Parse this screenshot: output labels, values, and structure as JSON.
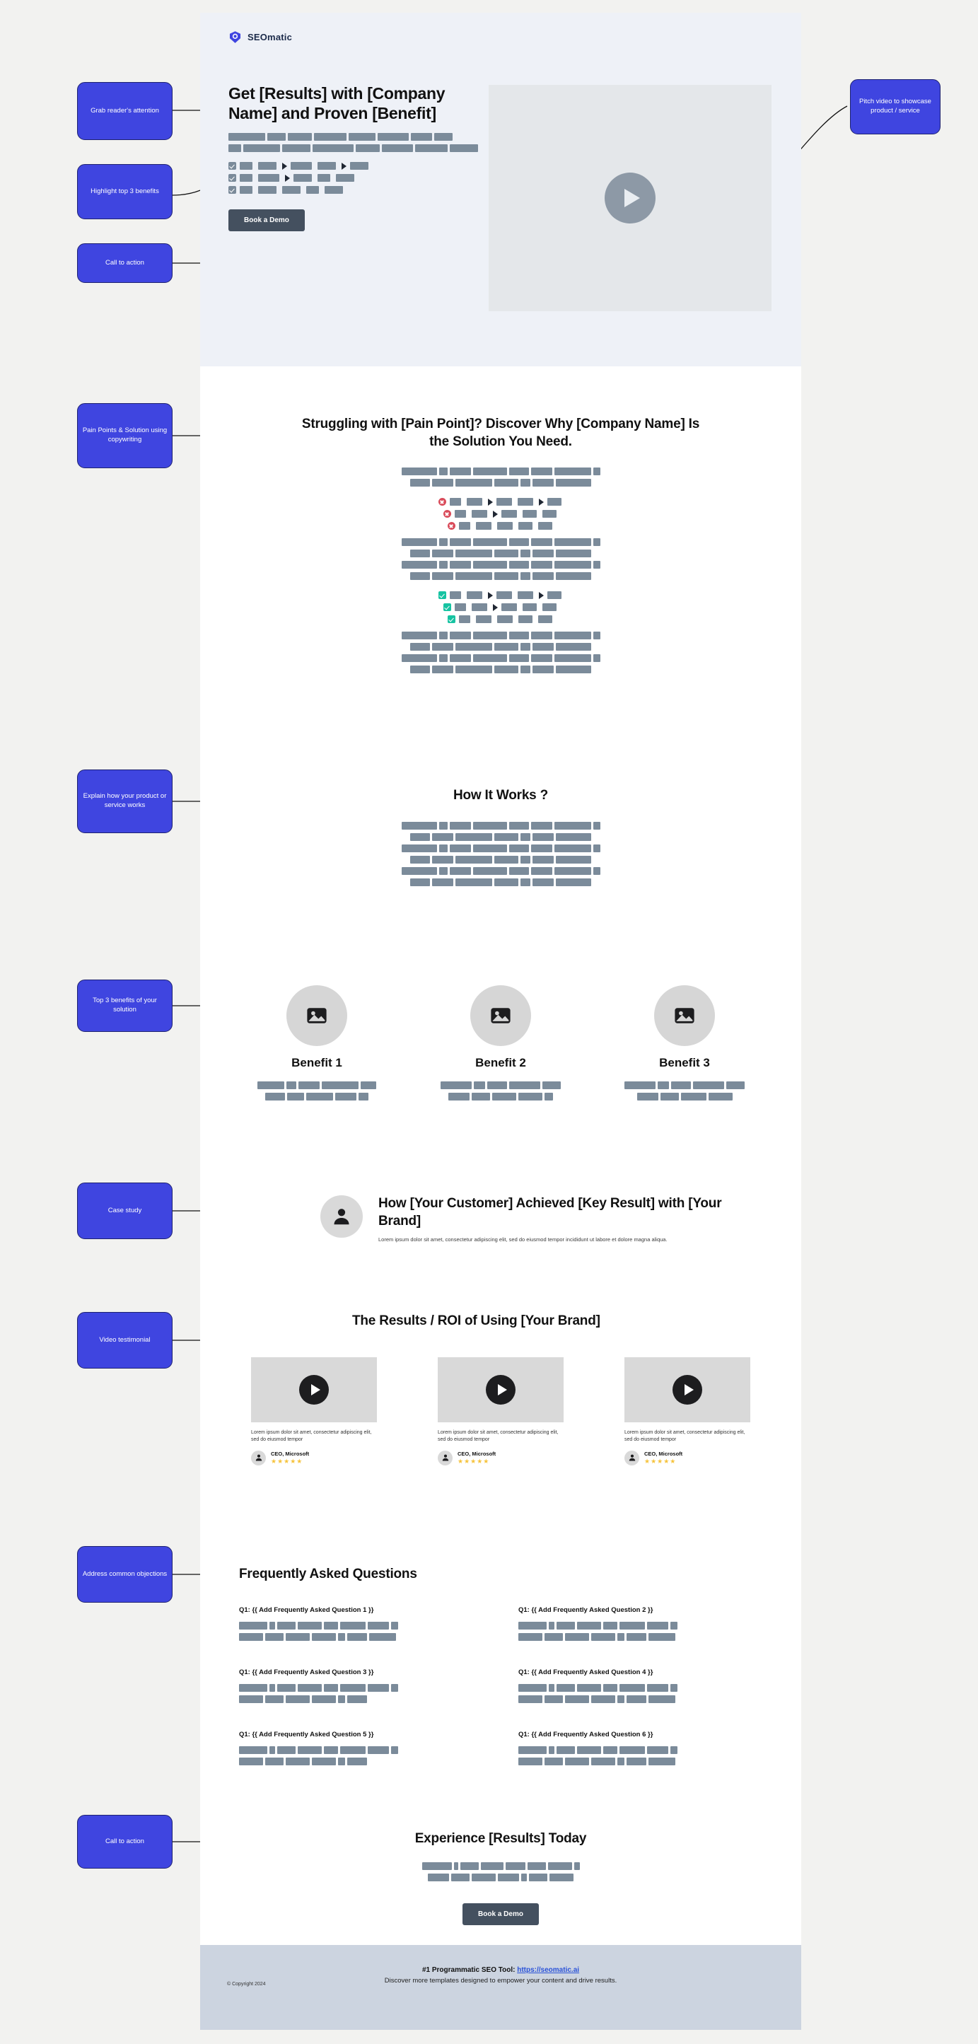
{
  "brand": {
    "name": "SEOmatic",
    "accent": "#3f45e0",
    "logo_icon": "seomatic-logo-icon"
  },
  "notes": [
    {
      "id": "n1",
      "label": "Grab reader's attention"
    },
    {
      "id": "n2",
      "label": "Highlight top 3 benefits"
    },
    {
      "id": "n3",
      "label": "Call to action"
    },
    {
      "id": "n4",
      "label": "Pitch video to showcase product / service"
    },
    {
      "id": "n5",
      "label": "Pain Points & Solution using copywriting"
    },
    {
      "id": "n6",
      "label": "Explain how your product or service works"
    },
    {
      "id": "n7",
      "label": "Top 3 benefits of your solution"
    },
    {
      "id": "n8",
      "label": "Case study"
    },
    {
      "id": "n9",
      "label": "Video testimonial"
    },
    {
      "id": "n10",
      "label": "Address common objections"
    },
    {
      "id": "n11",
      "label": "Call to action"
    }
  ],
  "hero": {
    "title": "Get [Results] with [Company Name] and Proven [Benefit]",
    "cta_label": "Book a Demo",
    "video_icon": "play-icon",
    "paragraph_rows": [
      [
        52,
        26,
        34,
        46,
        38,
        44,
        30,
        26
      ],
      [
        18,
        52,
        40,
        58,
        34,
        44,
        46,
        40
      ]
    ],
    "checklist": [
      {
        "state": "checked",
        "segments": [
          18,
          26,
          30,
          26,
          26
        ]
      },
      {
        "state": "checked",
        "segments": [
          18,
          30,
          26,
          18,
          26
        ]
      },
      {
        "state": "checked",
        "segments": [
          18,
          26,
          26,
          18,
          26
        ]
      }
    ]
  },
  "pain_section": {
    "title": "Struggling with [Pain Point]? Discover Why [Company Name] Is the Solution You Need.",
    "intro_rows": [
      [
        50,
        12,
        30,
        48,
        28,
        30,
        52,
        10
      ],
      [
        28,
        30,
        52,
        34,
        14,
        30,
        50
      ]
    ],
    "negatives": [
      {
        "state": "cross",
        "segments": [
          16,
          22,
          22,
          22,
          20
        ]
      },
      {
        "state": "cross",
        "segments": [
          16,
          22,
          22,
          20,
          20
        ]
      },
      {
        "state": "cross",
        "segments": [
          16,
          22,
          22,
          20,
          20
        ]
      }
    ],
    "mid_rows": [
      [
        50,
        12,
        30,
        48,
        28,
        30,
        52,
        10
      ],
      [
        28,
        30,
        52,
        34,
        14,
        30,
        50
      ],
      [
        50,
        12,
        30,
        48,
        28,
        30,
        52,
        10
      ],
      [
        28,
        30,
        52,
        34,
        14,
        30,
        50
      ]
    ],
    "positives": [
      {
        "state": "checked",
        "segments": [
          16,
          22,
          22,
          22,
          20
        ]
      },
      {
        "state": "checked",
        "segments": [
          16,
          22,
          22,
          20,
          20
        ]
      },
      {
        "state": "checked",
        "segments": [
          16,
          22,
          22,
          20,
          20
        ]
      }
    ],
    "end_rows": [
      [
        50,
        12,
        30,
        48,
        28,
        30,
        52,
        10
      ],
      [
        28,
        30,
        52,
        34,
        14,
        30,
        50
      ],
      [
        50,
        12,
        30,
        48,
        28,
        30,
        52,
        10
      ],
      [
        28,
        30,
        52,
        34,
        14,
        30,
        50
      ]
    ]
  },
  "how_it_works": {
    "title": "How It Works ?",
    "rows": [
      [
        50,
        12,
        30,
        48,
        28,
        30,
        52,
        10
      ],
      [
        28,
        30,
        52,
        34,
        14,
        30,
        50
      ],
      [
        50,
        12,
        30,
        48,
        28,
        30,
        52,
        10
      ],
      [
        28,
        30,
        52,
        34,
        14,
        30,
        50
      ],
      [
        50,
        12,
        30,
        48,
        28,
        30,
        52,
        10
      ],
      [
        28,
        30,
        52,
        34,
        14,
        30,
        50
      ]
    ]
  },
  "benefits": {
    "image_icon": "image-placeholder-icon",
    "items": [
      {
        "label": "Benefit 1",
        "rows": [
          [
            38,
            14,
            30,
            52,
            22
          ],
          [
            28,
            24,
            38,
            30,
            14
          ]
        ]
      },
      {
        "label": "Benefit 2",
        "rows": [
          [
            44,
            16,
            28,
            44,
            26
          ],
          [
            30,
            26,
            34,
            34,
            12
          ]
        ]
      },
      {
        "label": "Benefit 3",
        "rows": [
          [
            44,
            16,
            28,
            44,
            26
          ],
          [
            30,
            26,
            36,
            34
          ]
        ]
      }
    ]
  },
  "case_study": {
    "avatar_icon": "user-avatar-icon",
    "title": "How [Your Customer] Achieved [Key Result] with [Your Brand]",
    "body": "Lorem ipsum dolor sit amet, consectetur adipiscing elit, sed do eiusmod tempor incididunt ut labore et dolore magna aliqua."
  },
  "results": {
    "title": "The Results / ROI of Using [Your Brand]",
    "play_icon": "play-icon",
    "avatar_icon": "user-avatar-icon",
    "stars": "★★★★★",
    "cards": [
      {
        "quote": "Lorem ipsum dolor sit amet, consectetur adipiscing elit, sed do eiusmod tempor",
        "name": "CEO, Microsoft"
      },
      {
        "quote": "Lorem ipsum dolor sit amet, consectetur adipiscing elit, sed do eiusmod tempor",
        "name": "CEO, Microsoft"
      },
      {
        "quote": "Lorem ipsum dolor sit amet, consectetur adipiscing elit, sed do eiusmod tempor",
        "name": "CEO, Microsoft"
      }
    ]
  },
  "faq": {
    "title": "Frequently Asked Questions",
    "items": [
      {
        "question": "Q1: {{ Add Frequently Asked Question 1 }}",
        "rows": [
          [
            40,
            8,
            26,
            34,
            20,
            36,
            30,
            10
          ],
          [
            34,
            26,
            34,
            34,
            10,
            28,
            38
          ]
        ]
      },
      {
        "question": "Q1: {{ Add Frequently Asked Question 2 }}",
        "rows": [
          [
            40,
            8,
            26,
            34,
            20,
            36,
            30,
            10
          ],
          [
            34,
            26,
            34,
            34,
            10,
            28,
            38
          ]
        ]
      },
      {
        "question": "Q1: {{ Add Frequently Asked Question 3 }}",
        "rows": [
          [
            40,
            8,
            26,
            34,
            20,
            36,
            30,
            10
          ],
          [
            34,
            26,
            34,
            34,
            10,
            28
          ]
        ]
      },
      {
        "question": "Q1: {{ Add Frequently Asked Question 4 }}",
        "rows": [
          [
            40,
            8,
            26,
            34,
            20,
            36,
            30,
            10
          ],
          [
            34,
            26,
            34,
            34,
            10,
            28,
            38
          ]
        ]
      },
      {
        "question": "Q1: {{ Add Frequently Asked Question 5 }}",
        "rows": [
          [
            40,
            8,
            26,
            34,
            20,
            36,
            30,
            10
          ],
          [
            34,
            26,
            34,
            34,
            10,
            28
          ]
        ]
      },
      {
        "question": "Q1: {{ Add Frequently Asked Question 6 }}",
        "rows": [
          [
            40,
            8,
            26,
            34,
            20,
            36,
            30,
            10
          ],
          [
            34,
            26,
            34,
            34,
            10,
            28,
            38
          ]
        ]
      }
    ]
  },
  "final_cta": {
    "title": "Experience [Results] Today",
    "rows": [
      [
        42,
        6,
        26,
        32,
        28,
        26,
        34,
        8
      ],
      [
        30,
        26,
        34,
        30,
        8,
        26,
        34
      ]
    ],
    "button_label": "Book a Demo"
  },
  "footer": {
    "copyright": "© Copyright 2024",
    "headline_prefix": "#1 Programmatic SEO Tool: ",
    "link_text": "https://seomatic.ai",
    "tagline": "Discover more templates designed to empower your content and drive results."
  }
}
